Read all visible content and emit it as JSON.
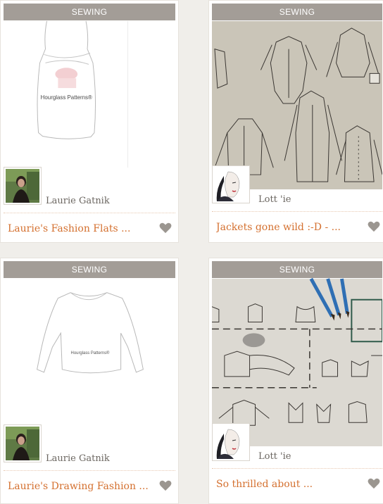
{
  "cards": [
    {
      "category": "SEWING",
      "author": "Laurie Gatnik",
      "title": "Laurie's Fashion Flats ...",
      "image_caption": "Hourglass Patterns®",
      "avatar_icon": "person-portrait-icon",
      "like_icon": "heart-icon"
    },
    {
      "category": "SEWING",
      "author": "Lott 'ie",
      "title": "Jackets gone wild :-D - ...",
      "avatar_icon": "sketch-face-portrait-icon",
      "like_icon": "heart-icon"
    },
    {
      "category": "SEWING",
      "author": "Laurie Gatnik",
      "title": "Laurie's Drawing Fashion ...",
      "image_caption": "Hourglass Patterns®",
      "avatar_icon": "person-portrait-icon",
      "like_icon": "heart-icon"
    },
    {
      "category": "SEWING",
      "author": "Lott 'ie",
      "title": "So thrilled about ...",
      "avatar_icon": "sketch-face-portrait-icon",
      "like_icon": "heart-icon"
    }
  ],
  "colors": {
    "category_bar": "#a39d97",
    "title_text": "#d4702f",
    "author_text": "#6b6660",
    "heart": "#9b9690",
    "page_bg": "#f0eeea"
  }
}
